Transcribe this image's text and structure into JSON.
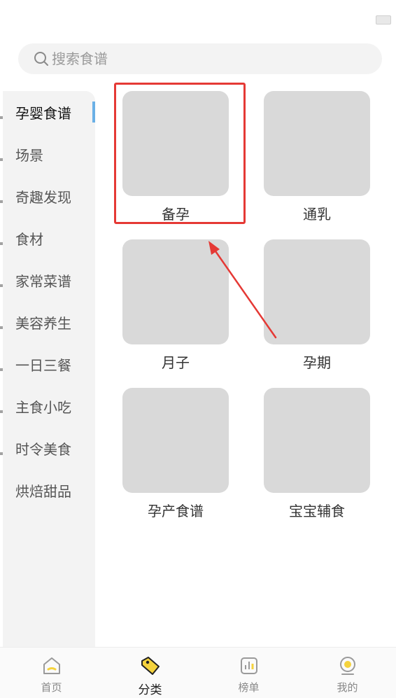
{
  "search": {
    "placeholder": "搜索食谱"
  },
  "sidebar": {
    "items": [
      {
        "label": "孕婴食谱",
        "active": true
      },
      {
        "label": "场景"
      },
      {
        "label": "奇趣发现"
      },
      {
        "label": "食材"
      },
      {
        "label": "家常菜谱"
      },
      {
        "label": "美容养生"
      },
      {
        "label": "一日三餐"
      },
      {
        "label": "主食小吃"
      },
      {
        "label": "时令美食"
      },
      {
        "label": "烘焙甜品"
      }
    ]
  },
  "categories": [
    {
      "label": "备孕"
    },
    {
      "label": "通乳"
    },
    {
      "label": "月子"
    },
    {
      "label": "孕期"
    },
    {
      "label": "孕产食谱"
    },
    {
      "label": "宝宝辅食"
    }
  ],
  "tabbar": {
    "tabs": [
      {
        "label": "首页",
        "icon": "home-icon"
      },
      {
        "label": "分类",
        "icon": "tag-icon",
        "active": true
      },
      {
        "label": "榜单",
        "icon": "chart-icon"
      },
      {
        "label": "我的",
        "icon": "user-icon"
      }
    ]
  },
  "colors": {
    "accent": "#6ab0e6",
    "highlight": "#e53935",
    "thumb": "#d9d9d9",
    "tab_icon_accent": "#f5d33d"
  }
}
